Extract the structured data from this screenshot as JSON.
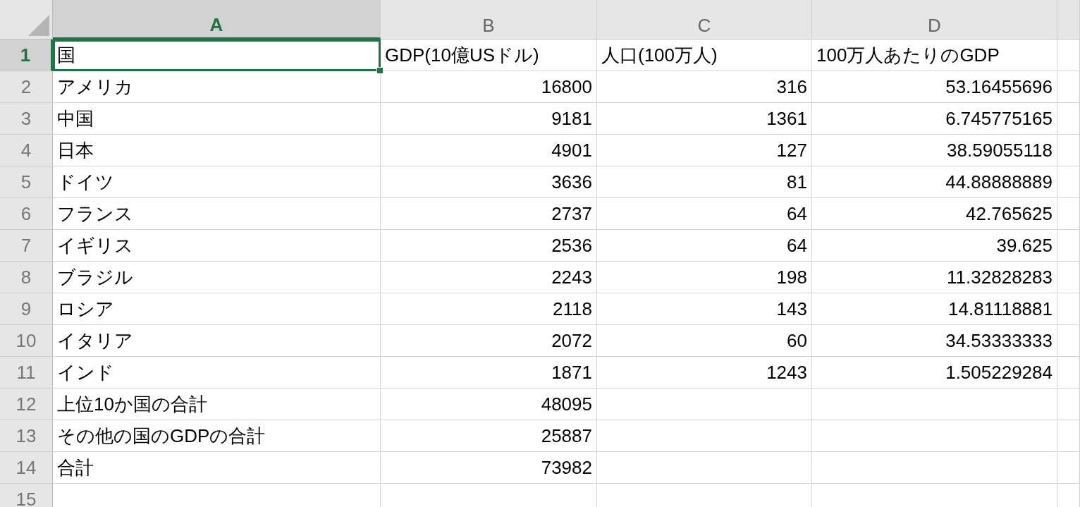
{
  "columns": [
    {
      "label": "A",
      "selected": true
    },
    {
      "label": "B",
      "selected": false
    },
    {
      "label": "C",
      "selected": false
    },
    {
      "label": "D",
      "selected": false
    }
  ],
  "rows": [
    {
      "number": "1",
      "selected": true,
      "kind": "header",
      "cells": [
        "国",
        "GDP(10億USドル)",
        "人口(100万人)",
        "100万人あたりのGDP"
      ]
    },
    {
      "number": "2",
      "selected": false,
      "kind": "data",
      "cells": [
        "アメリカ",
        "16800",
        "316",
        "53.16455696"
      ]
    },
    {
      "number": "3",
      "selected": false,
      "kind": "data",
      "cells": [
        "中国",
        "9181",
        "1361",
        "6.745775165"
      ]
    },
    {
      "number": "4",
      "selected": false,
      "kind": "data",
      "cells": [
        "日本",
        "4901",
        "127",
        "38.59055118"
      ]
    },
    {
      "number": "5",
      "selected": false,
      "kind": "data",
      "cells": [
        "ドイツ",
        "3636",
        "81",
        "44.88888889"
      ]
    },
    {
      "number": "6",
      "selected": false,
      "kind": "data",
      "cells": [
        "フランス",
        "2737",
        "64",
        "42.765625"
      ]
    },
    {
      "number": "7",
      "selected": false,
      "kind": "data",
      "cells": [
        "イギリス",
        "2536",
        "64",
        "39.625"
      ]
    },
    {
      "number": "8",
      "selected": false,
      "kind": "data",
      "cells": [
        "ブラジル",
        "2243",
        "198",
        "11.32828283"
      ]
    },
    {
      "number": "9",
      "selected": false,
      "kind": "data",
      "cells": [
        "ロシア",
        "2118",
        "143",
        "14.81118881"
      ]
    },
    {
      "number": "10",
      "selected": false,
      "kind": "data",
      "cells": [
        "イタリア",
        "2072",
        "60",
        "34.53333333"
      ]
    },
    {
      "number": "11",
      "selected": false,
      "kind": "data",
      "cells": [
        "インド",
        "1871",
        "1243",
        "1.505229284"
      ]
    },
    {
      "number": "12",
      "selected": false,
      "kind": "data",
      "cells": [
        "上位10か国の合計",
        "48095"
      ]
    },
    {
      "number": "13",
      "selected": false,
      "kind": "data",
      "cells": [
        "その他の国のGDPの合計",
        "25887"
      ]
    },
    {
      "number": "14",
      "selected": false,
      "kind": "data",
      "cells": [
        "合計",
        "73982"
      ]
    },
    {
      "number": "15",
      "selected": false,
      "kind": "data",
      "cells": []
    }
  ]
}
